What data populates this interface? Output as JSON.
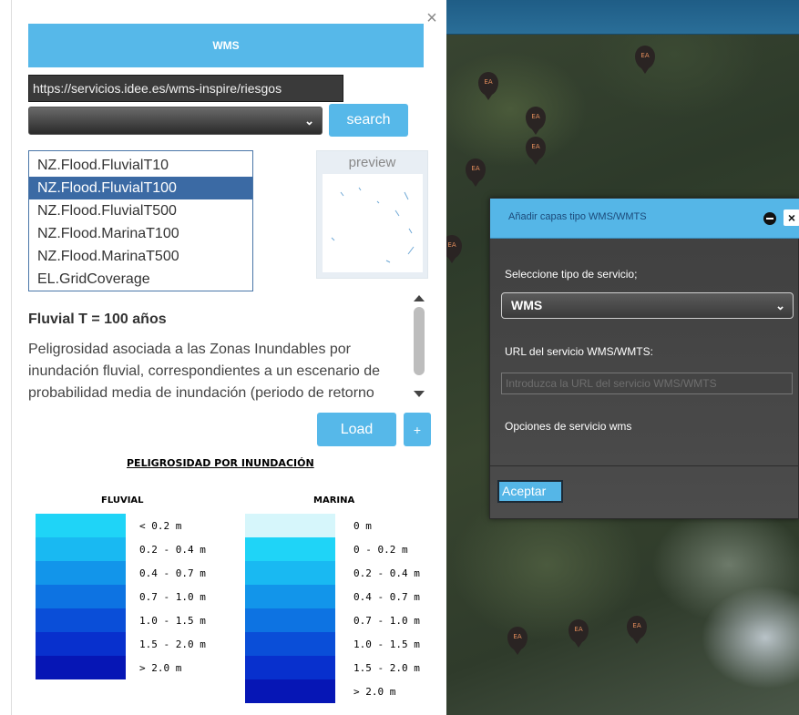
{
  "wms_panel": {
    "header_title": "WMS",
    "close_icon": "close-icon",
    "url_value": "https://servicios.idee.es/wms-inspire/riesgos",
    "search_label": "search",
    "preview_label": "preview",
    "layers": [
      {
        "name": "NZ.Flood.FluvialT10",
        "selected": false
      },
      {
        "name": "NZ.Flood.FluvialT100",
        "selected": true
      },
      {
        "name": "NZ.Flood.FluvialT500",
        "selected": false
      },
      {
        "name": "NZ.Flood.MarinaT100",
        "selected": false
      },
      {
        "name": "NZ.Flood.MarinaT500",
        "selected": false
      },
      {
        "name": "EL.GridCoverage",
        "selected": false
      }
    ],
    "description_title": "Fluvial T = 100 años",
    "description_text": "Peligrosidad asociada a las Zonas Inundables por inundación fluvial, correspondientes a un escenario de probabilidad media de inundación (periodo de retorno",
    "load_label": "Load",
    "plus_label": "+"
  },
  "legend": {
    "title": "PELIGROSIDAD POR INUNDACIÓN",
    "fluvial": {
      "title": "FLUVIAL",
      "items": [
        {
          "label": "< 0.2 m",
          "color": "#1fd4f7"
        },
        {
          "label": "0.2 - 0.4 m",
          "color": "#19b9f2"
        },
        {
          "label": "0.4 - 0.7 m",
          "color": "#1295ea"
        },
        {
          "label": "0.7 - 1.0 m",
          "color": "#0d73e2"
        },
        {
          "label": "1.0 - 1.5 m",
          "color": "#0a4ed8"
        },
        {
          "label": "1.5 - 2.0 m",
          "color": "#0830cd"
        },
        {
          "label": "> 2.0 m",
          "color": "#0616b5"
        }
      ]
    },
    "marina": {
      "title": "MARINA",
      "items": [
        {
          "label": "0 m",
          "color": "#d6f6fb"
        },
        {
          "label": "0 - 0.2 m",
          "color": "#1fd4f7"
        },
        {
          "label": "0.2 - 0.4 m",
          "color": "#19b9f2"
        },
        {
          "label": "0.4 - 0.7 m",
          "color": "#1295ea"
        },
        {
          "label": "0.7 - 1.0 m",
          "color": "#0d73e2"
        },
        {
          "label": "1.0 - 1.5 m",
          "color": "#0a4ed8"
        },
        {
          "label": "1.5 - 2.0 m",
          "color": "#0830cd"
        },
        {
          "label": "> 2.0 m",
          "color": "#0616b5"
        }
      ]
    }
  },
  "dialog": {
    "title": "Añadir capas tipo WMS/WMTS",
    "service_type_label": "Seleccione tipo de servicio;",
    "service_type_value": "WMS",
    "url_label": "URL del servicio WMS/WMTS:",
    "url_placeholder": "Introduzca la URL del servicio WMS/WMTS",
    "options_label": "Opciones de servicio wms",
    "accept_label": "Aceptar"
  },
  "map": {
    "marker_label": "EA"
  },
  "colors": {
    "accent": "#56b8e9",
    "selected": "#3b6aa4"
  }
}
